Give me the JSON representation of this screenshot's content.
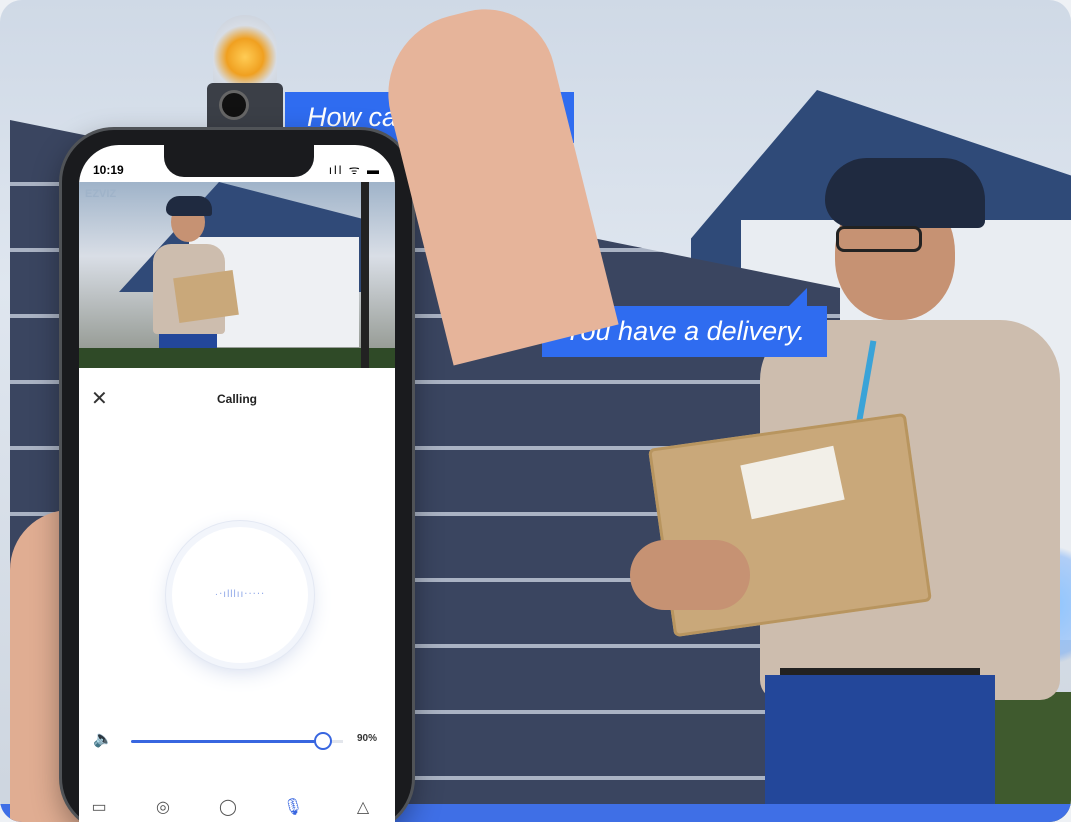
{
  "bubbles": {
    "top": "How can I help you?",
    "right": "You have a delivery."
  },
  "phone": {
    "status_time": "10:19",
    "status_icons": "ıll ᯤ ▬",
    "feed_logo": "EZVIZ",
    "call_title": "Calling",
    "volume": {
      "value": 0.9,
      "label": "90%"
    },
    "tabs": [
      {
        "icon": "camera-icon",
        "glyph": "▭"
      },
      {
        "icon": "ptz-icon",
        "glyph": "◎"
      },
      {
        "icon": "chat-icon",
        "glyph": "◯"
      },
      {
        "icon": "voice-icon",
        "glyph": "🎙"
      },
      {
        "icon": "bell-icon",
        "glyph": "△"
      }
    ]
  },
  "colors": {
    "accent": "#2f6cf0",
    "slider": "#3866e0"
  }
}
